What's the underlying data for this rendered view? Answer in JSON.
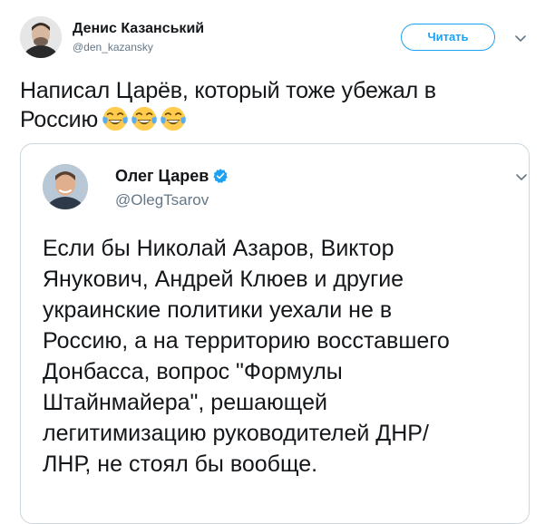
{
  "tweet": {
    "author": {
      "name": "Денис Казанський",
      "handle": "@den_kazansky",
      "avatar_icon": "user-avatar"
    },
    "follow_label": "Читать",
    "menu_icon": "chevron-down-icon",
    "text_lines": [
      "Написал Царёв, который тоже убежал в",
      "Россию"
    ],
    "emojis": [
      "face-with-tears-of-joy",
      "face-with-tears-of-joy",
      "face-with-tears-of-joy"
    ]
  },
  "quoted_tweet": {
    "author": {
      "name": "Олег Царев",
      "handle": "@OlegTsarov",
      "verified": true,
      "avatar_icon": "user-avatar"
    },
    "menu_icon": "chevron-down-icon",
    "text_lines": [
      "Если бы Николай Азаров, Виктор",
      "Янукович, Андрей Клюев и другие",
      "украинские политики уехали не в",
      "Россию, а на территорию восставшего",
      "Донбасса, вопрос \"Формулы",
      "Штайнмайера\", решающей",
      "легитимизацию руководителей ДНР/",
      "ЛНР, не стоял бы вообще."
    ]
  },
  "colors": {
    "accent": "#1da1f2",
    "secondary_text": "#657786",
    "border": "#ccd6dd",
    "text": "#14171a"
  }
}
